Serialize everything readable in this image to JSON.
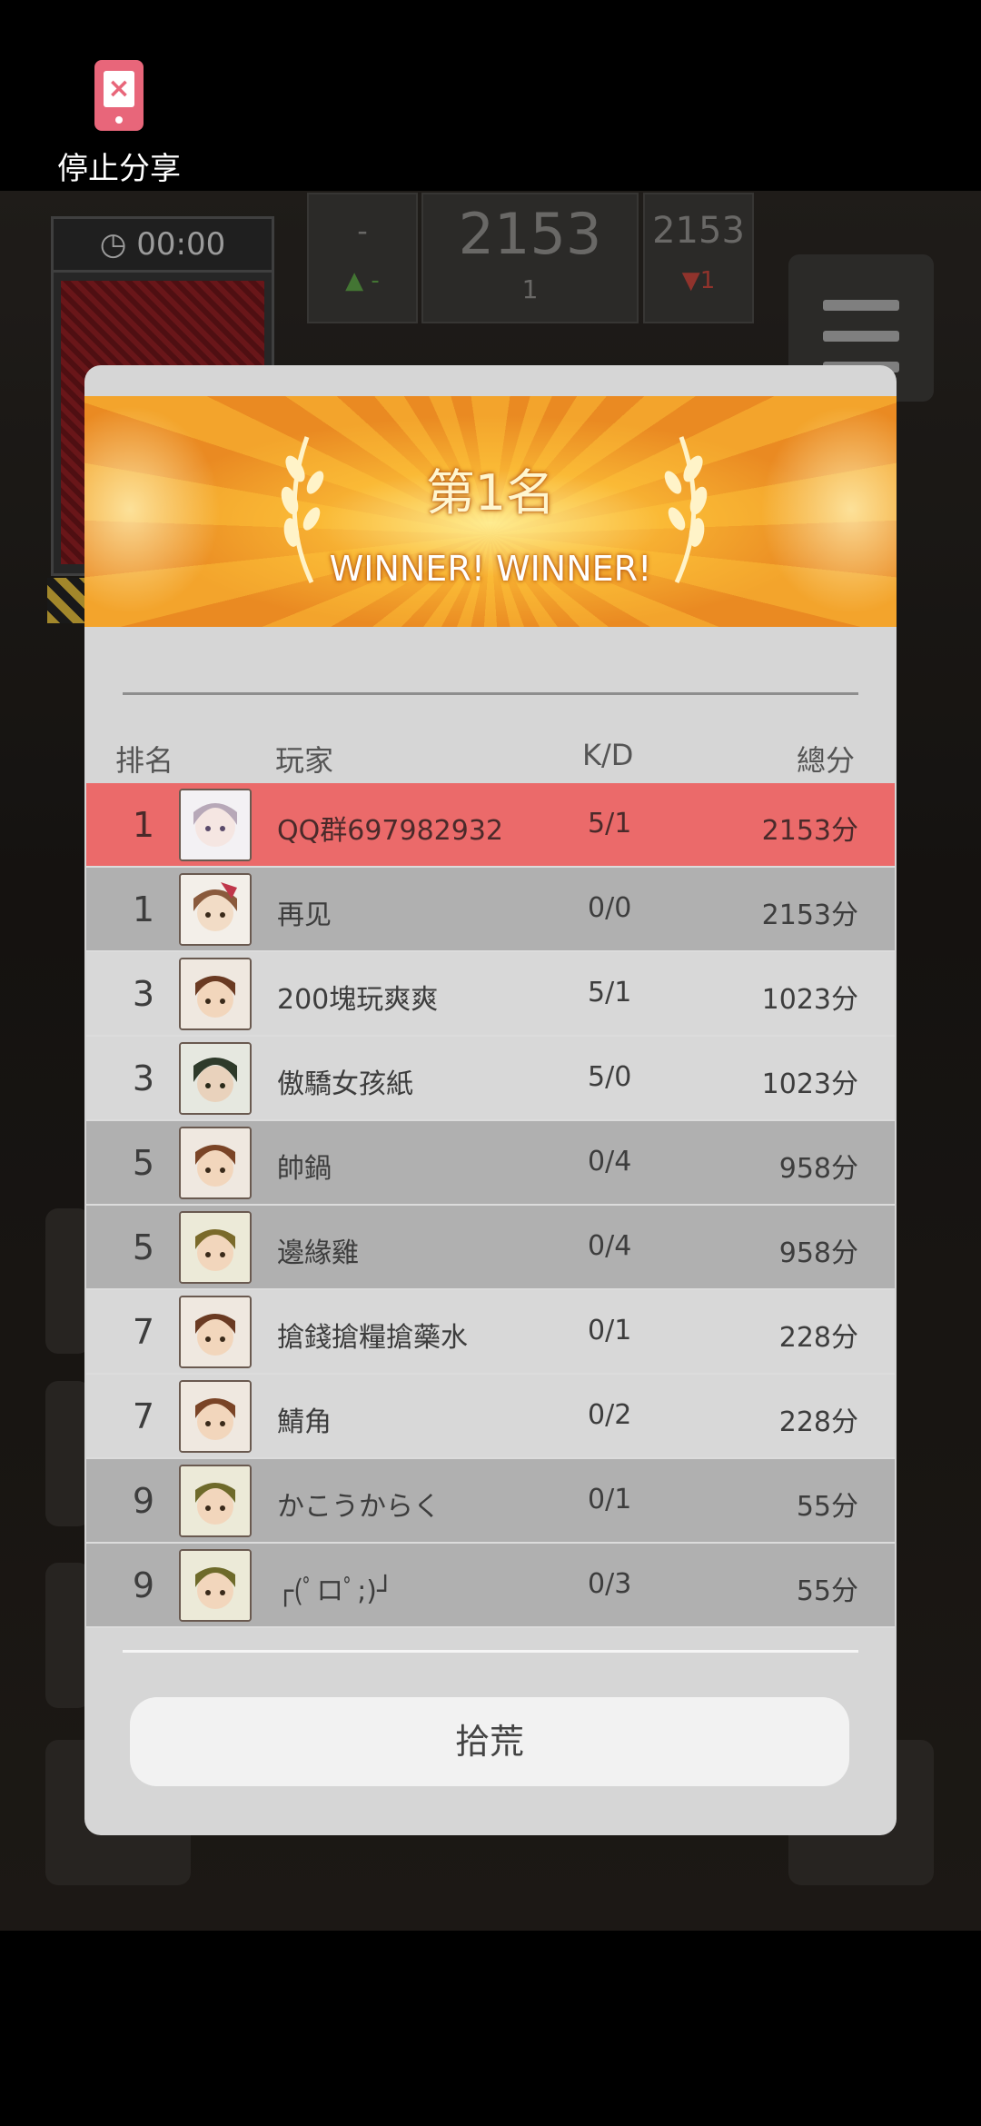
{
  "share": {
    "label": "停止分享"
  },
  "hud": {
    "timer": "00:00",
    "left_box": {
      "value": "-",
      "sub": "▲ -"
    },
    "main_score": {
      "value": "2153",
      "sub": "1"
    },
    "right_box": {
      "value": "2153",
      "sub": "▼1"
    }
  },
  "dialog": {
    "rank_title": "第1名",
    "winner_text": "WINNER! WINNER!",
    "columns": {
      "rank": "排名",
      "player": "玩家",
      "kd": "K/D",
      "total": "總分"
    },
    "rows": [
      {
        "rank": "1",
        "name": "QQ群697982932",
        "kd": "5/1",
        "total": "2153分"
      },
      {
        "rank": "1",
        "name": "再见",
        "kd": "0/0",
        "total": "2153分"
      },
      {
        "rank": "3",
        "name": "200塊玩爽爽",
        "kd": "5/1",
        "total": "1023分"
      },
      {
        "rank": "3",
        "name": "傲驕女孩紙",
        "kd": "5/0",
        "total": "1023分"
      },
      {
        "rank": "5",
        "name": "帥鍋",
        "kd": "0/4",
        "total": "958分"
      },
      {
        "rank": "5",
        "name": "邊緣雞",
        "kd": "0/4",
        "total": "958分"
      },
      {
        "rank": "7",
        "name": "搶錢搶糧搶藥水",
        "kd": "0/1",
        "total": "228分"
      },
      {
        "rank": "7",
        "name": "鯖角",
        "kd": "0/2",
        "total": "228分"
      },
      {
        "rank": "9",
        "name": "かこうからく",
        "kd": "0/1",
        "total": "55分"
      },
      {
        "rank": "9",
        "name": "┌(ﾟロﾟ;)┘",
        "kd": "0/3",
        "total": "55分"
      }
    ],
    "confirm_button": "拾荒"
  }
}
